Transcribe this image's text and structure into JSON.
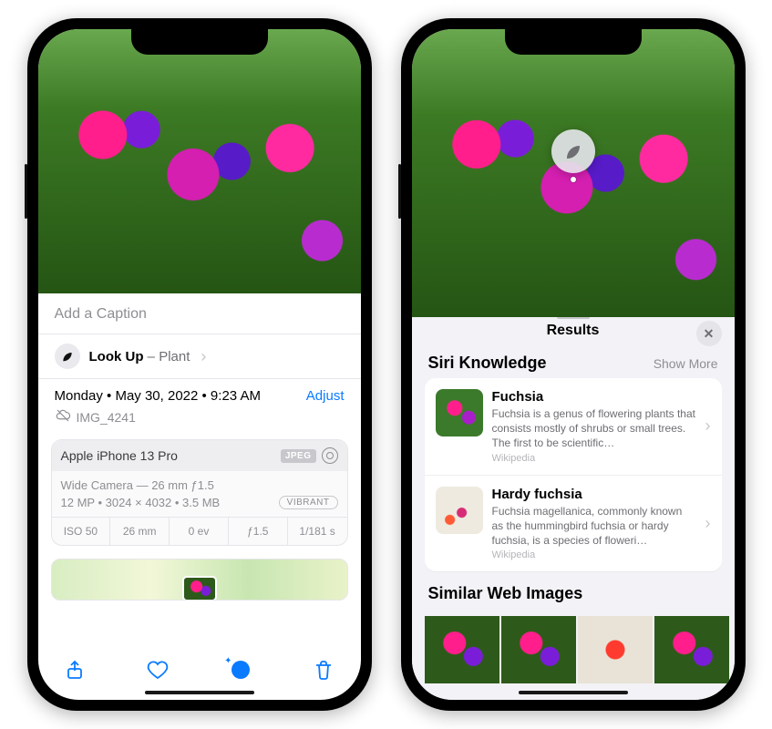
{
  "left": {
    "caption_placeholder": "Add a Caption",
    "lookup_label_bold": "Look Up",
    "lookup_label_sep": " – ",
    "lookup_label_kind": "Plant",
    "date_text": "Monday • May 30, 2022 • 9:23 AM",
    "adjust": "Adjust",
    "filename": "IMG_4241",
    "meta": {
      "device": "Apple iPhone 13 Pro",
      "format": "JPEG",
      "lens_line": "Wide Camera — 26 mm ƒ1.5",
      "size_line": "12 MP  •  3024 × 4032  •  3.5 MB",
      "vibrant": "VIBRANT",
      "grid": {
        "iso": "ISO 50",
        "focal": "26 mm",
        "ev": "0 ev",
        "f": "ƒ1.5",
        "shutter": "1/181 s"
      }
    }
  },
  "right": {
    "sheet_title": "Results",
    "siri_section": "Siri Knowledge",
    "show_more": "Show More",
    "k1": {
      "title": "Fuchsia",
      "desc": "Fuchsia is a genus of flowering plants that consists mostly of shrubs or small trees. The first to be scientific…",
      "source": "Wikipedia"
    },
    "k2": {
      "title": "Hardy fuchsia",
      "desc": "Fuchsia magellanica, commonly known as the hummingbird fuchsia or hardy fuchsia, is a species of floweri…",
      "source": "Wikipedia"
    },
    "web_section": "Similar Web Images"
  }
}
